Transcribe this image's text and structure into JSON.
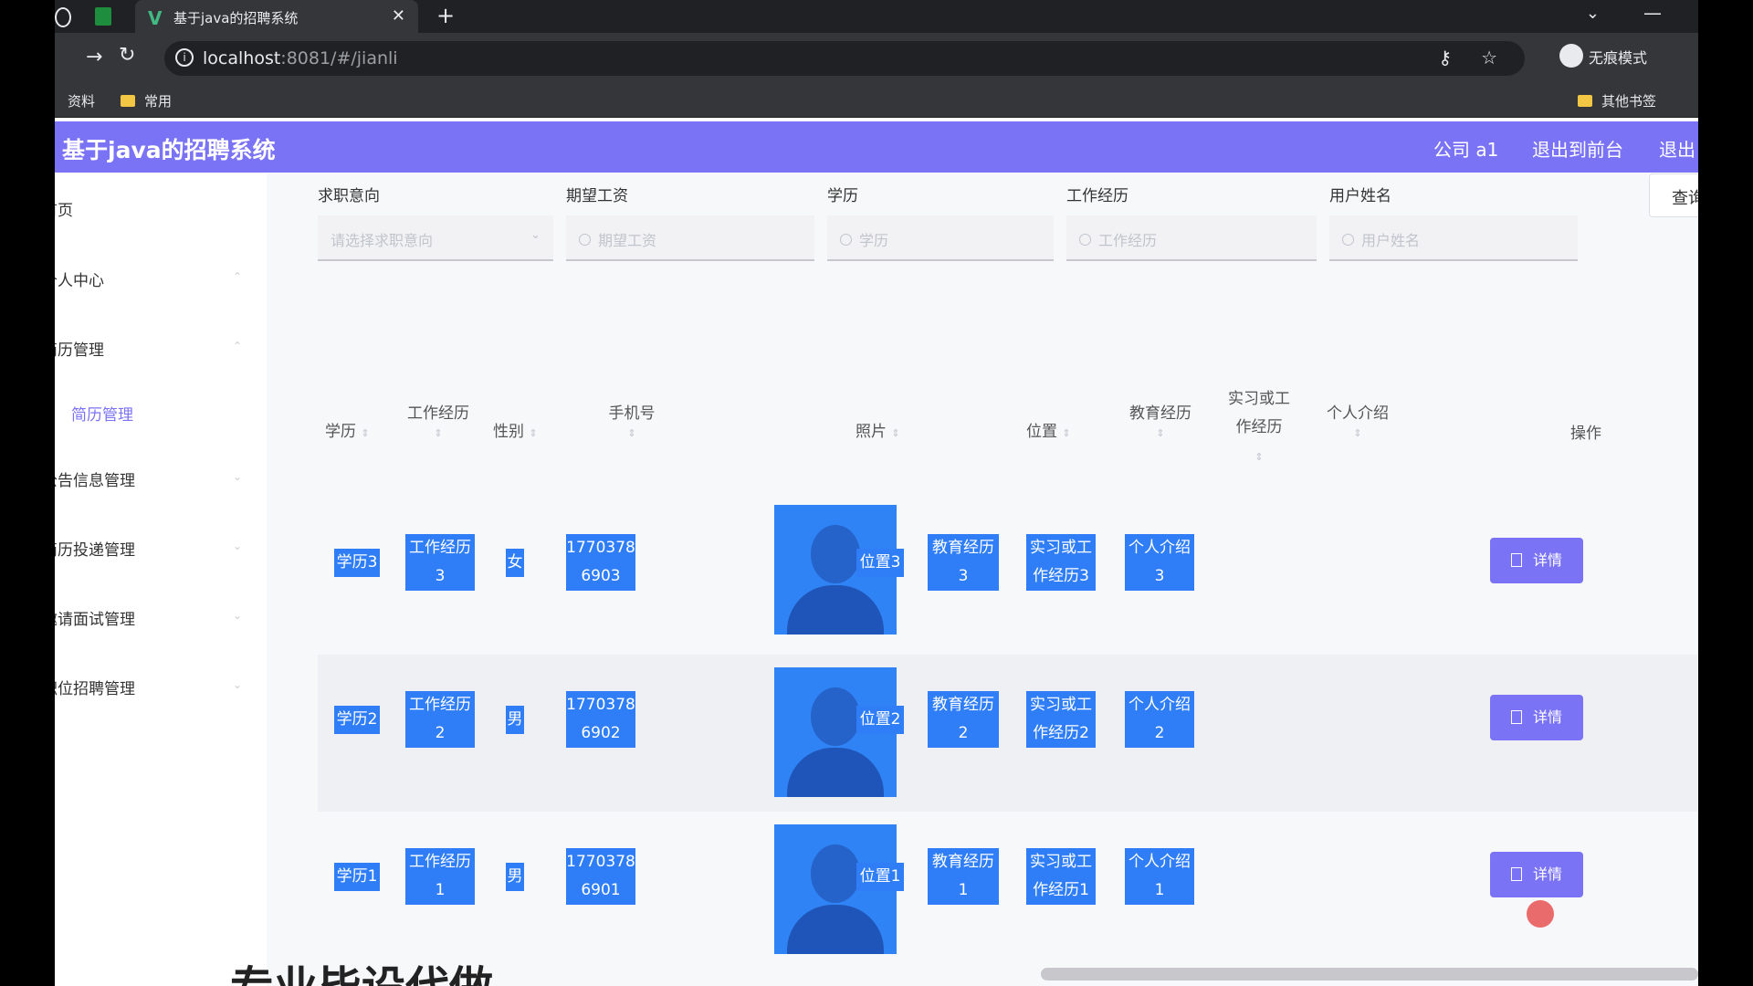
{
  "browser": {
    "tab_title": "基于java的招聘系统",
    "url_host": "localhost",
    "url_path": ":8081/#/jianli",
    "incognito_label": "无痕模式",
    "bookmarks": [
      "资料",
      "常用"
    ],
    "other_bookmarks": "其他书签"
  },
  "app": {
    "title": "基于java的招聘系统",
    "user": "公司 a1",
    "to_front": "退出到前台",
    "logout": "退出"
  },
  "sidebar": {
    "items": [
      "首页",
      "个人中心",
      "简历管理",
      "简历管理",
      "公告信息管理",
      "简历投递管理",
      "邀请面试管理",
      "职位招聘管理"
    ]
  },
  "filters": {
    "labels": [
      "求职意向",
      "期望工资",
      "学历",
      "工作经历",
      "用户姓名"
    ],
    "placeholders": [
      "请选择求职意向",
      "期望工资",
      "学历",
      "工作经历",
      "用户姓名"
    ],
    "query_button": "查询"
  },
  "table": {
    "headers": {
      "edu": "学历",
      "work": "工作经历",
      "gender": "性别",
      "phone": "手机号",
      "photo": "照片",
      "location": "位置",
      "edu_exp": "教育经历",
      "intern_a": "实习或工",
      "intern_b": "作经历",
      "intro": "个人介绍",
      "ops": "操作"
    },
    "rows": [
      {
        "edu": "学历3",
        "work_a": "工作经历",
        "work_b": "3",
        "gender": "女",
        "phone_a": "1770378",
        "phone_b": "6903",
        "location": "位置3",
        "edu_exp_a": "教育经历",
        "edu_exp_b": "3",
        "intern_a": "实习或工",
        "intern_b": "作经历3",
        "intro_a": "个人介绍",
        "intro_b": "3"
      },
      {
        "edu": "学历2",
        "work_a": "工作经历",
        "work_b": "2",
        "gender": "男",
        "phone_a": "1770378",
        "phone_b": "6902",
        "location": "位置2",
        "edu_exp_a": "教育经历",
        "edu_exp_b": "2",
        "intern_a": "实习或工",
        "intern_b": "作经历2",
        "intro_a": "个人介绍",
        "intro_b": "2"
      },
      {
        "edu": "学历1",
        "work_a": "工作经历",
        "work_b": "1",
        "gender": "男",
        "phone_a": "1770378",
        "phone_b": "6901",
        "location": "位置1",
        "edu_exp_a": "教育经历",
        "edu_exp_b": "1",
        "intern_a": "实习或工",
        "intern_b": "作经历1",
        "intro_a": "个人介绍",
        "intro_b": "1"
      }
    ],
    "detail_button": "详情"
  },
  "overlay_text": "专业毕设代做",
  "colors": {
    "accent": "#7b73f5",
    "selection": "#2f7ef7"
  }
}
